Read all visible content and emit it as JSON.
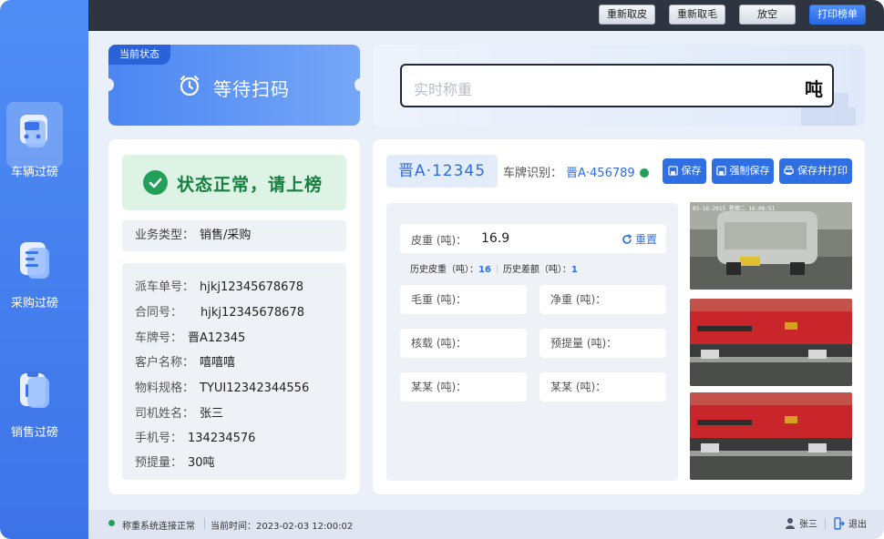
{
  "sidebar": {
    "items": [
      {
        "label": "车辆过磅",
        "icon": "truck-icon",
        "active": true
      },
      {
        "label": "采购过磅",
        "icon": "document-icon",
        "active": false
      },
      {
        "label": "销售过磅",
        "icon": "clipboard-icon",
        "active": false
      }
    ]
  },
  "topbar": {
    "buttons": [
      "重新取皮",
      "重新取毛",
      "放空",
      "打印榜单"
    ]
  },
  "status": {
    "tag": "当前状态",
    "title": "等待扫码"
  },
  "weight": {
    "placeholder": "实时称重",
    "unit": "吨"
  },
  "left": {
    "banner": "状态正常，请上榜",
    "biz_label": "业务类型：",
    "biz_value": "销售/采购",
    "fields": [
      {
        "label": "派车单号：",
        "value": "hjkj12345678678"
      },
      {
        "label": "合同号：",
        "value": "hjkj12345678678"
      },
      {
        "label": "车牌号：",
        "value": "晋A12345"
      },
      {
        "label": "客户名称：",
        "value": "嘻嘻嘻"
      },
      {
        "label": "物料规格：",
        "value": "TYUI12342344556"
      },
      {
        "label": "司机姓名：",
        "value": "张三"
      },
      {
        "label": "手机号：",
        "value": "134234576"
      },
      {
        "label": "预提量：",
        "value": "30吨"
      }
    ]
  },
  "right": {
    "plate": "晋A·12345",
    "recog_label": "车牌识别：",
    "recog_value": "晋A·456789",
    "actions": [
      "保存",
      "强制保存",
      "保存并打印"
    ],
    "tare_label": "皮重 (吨)：",
    "tare_value": "16.9",
    "reset_label": "重置",
    "hist_tare_label": "历史皮重（吨）：",
    "hist_tare_value": "16",
    "hist_diff_label": "历史差额（吨）：",
    "hist_diff_value": "1",
    "fields": [
      "毛重 (吨)：",
      "净重 (吨)：",
      "核载 (吨)：",
      "预提量 (吨)：",
      "某某 (吨)：",
      "某某 (吨)："
    ],
    "photo_caption": "03-16-2015 星期二 16:08:51"
  },
  "footer": {
    "connection": "称重系统连接正常",
    "time_label": "当前时间：",
    "time_value": "2023-02-03 12:00:02",
    "user": "张三",
    "logout": "退出"
  },
  "colors": {
    "primary": "#2f6fe4",
    "sidebar": "#4f8df5",
    "success": "#22a05a"
  }
}
